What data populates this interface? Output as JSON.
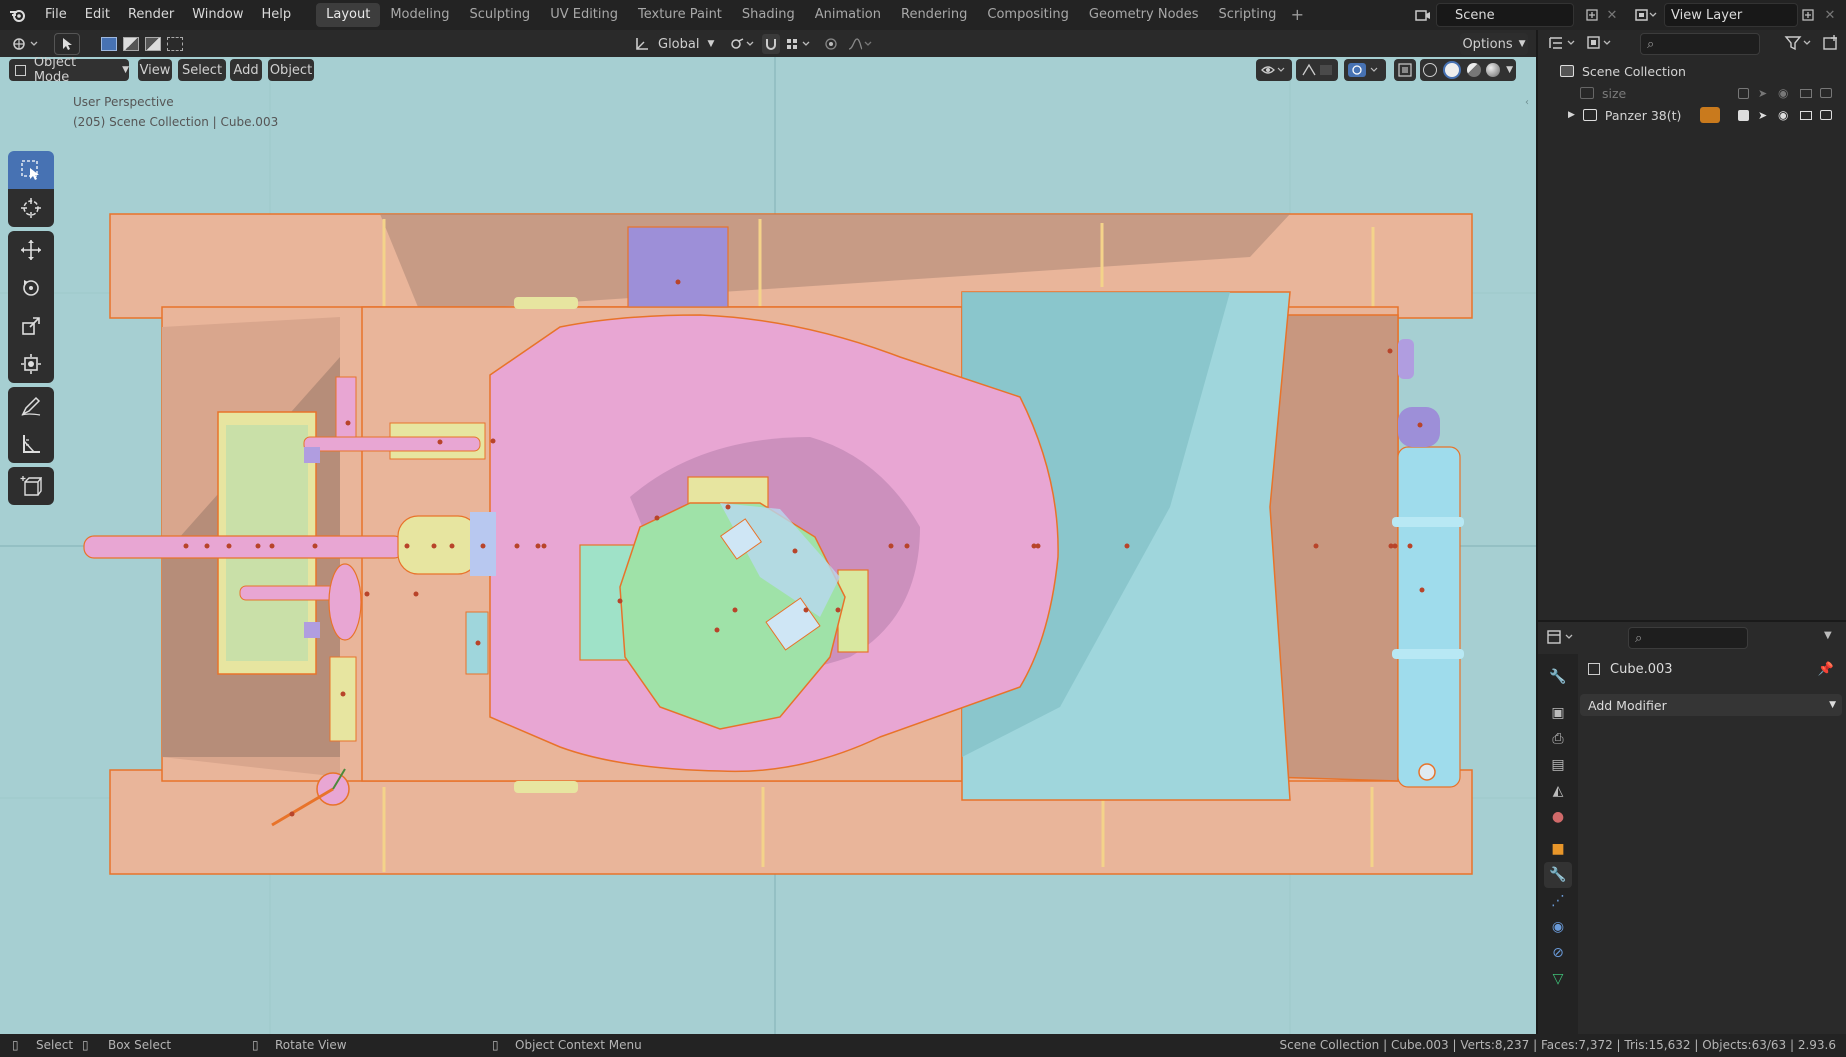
{
  "topbar": {
    "menu": [
      "File",
      "Edit",
      "Render",
      "Window",
      "Help"
    ],
    "workspaces": [
      {
        "label": "Layout",
        "active": true
      },
      {
        "label": "Modeling",
        "active": false
      },
      {
        "label": "Sculpting",
        "active": false
      },
      {
        "label": "UV Editing",
        "active": false
      },
      {
        "label": "Texture Paint",
        "active": false
      },
      {
        "label": "Shading",
        "active": false
      },
      {
        "label": "Animation",
        "active": false
      },
      {
        "label": "Rendering",
        "active": false
      },
      {
        "label": "Compositing",
        "active": false
      },
      {
        "label": "Geometry Nodes",
        "active": false
      },
      {
        "label": "Scripting",
        "active": false
      }
    ],
    "add_tab": "+",
    "scene_name": "Scene",
    "view_layer": "View Layer"
  },
  "header": {
    "transform_orientation": "Global",
    "options_label": "Options"
  },
  "viewport": {
    "mode": "Object Mode",
    "menus": [
      "View",
      "Select",
      "Add",
      "Object"
    ],
    "overlay_line1": "User Perspective",
    "overlay_line2": "(205) Scene Collection | Cube.003",
    "background_color": "#a6cfd2"
  },
  "outliner": {
    "root": "Scene Collection",
    "items": [
      {
        "label": "size",
        "dimmed": true
      },
      {
        "label": "Panzer 38(t)",
        "dimmed": false
      }
    ]
  },
  "properties": {
    "object_name": "Cube.003",
    "add_modifier_label": "Add Modifier"
  },
  "statusbar": {
    "select": "Select",
    "box_select": "Box Select",
    "rotate_view": "Rotate View",
    "context_menu": "Object Context Menu",
    "stats": "Scene Collection | Cube.003 | Verts:8,237 | Faces:7,372 | Tris:15,632 | Objects:63/63 | 2.93.6"
  },
  "colors": {
    "accent": "#4772b3",
    "hull": "#e9b59a",
    "turret": "#e8a6d3",
    "cupola": "#9fe2a8",
    "engine_deck": "#9fd6dc",
    "selection_outline": "#e8732a"
  }
}
